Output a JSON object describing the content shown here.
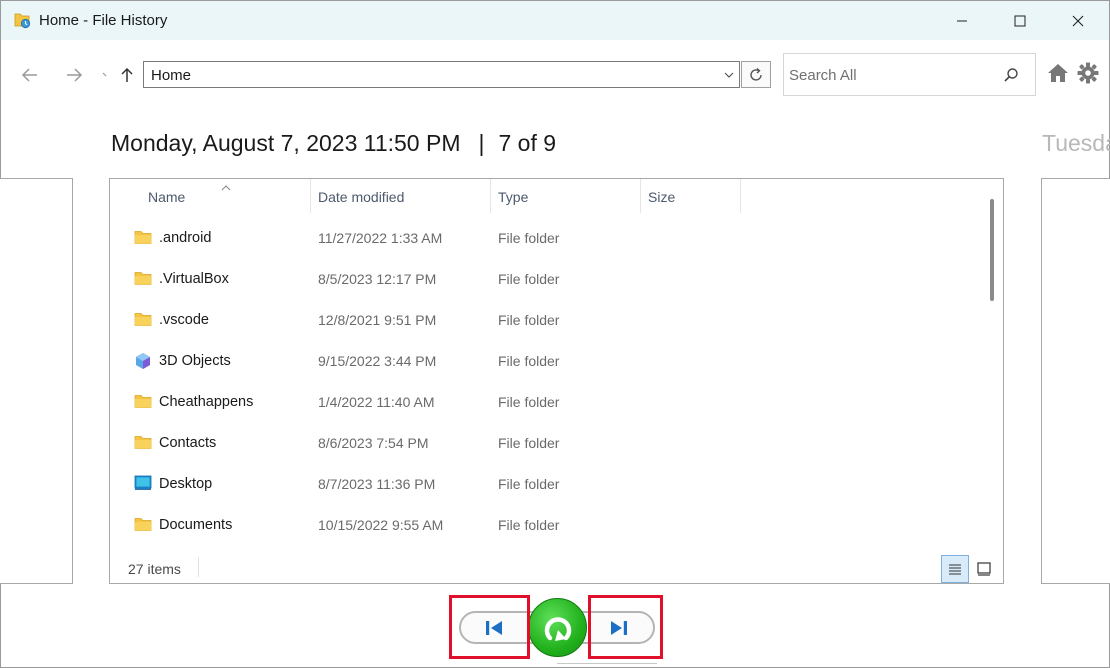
{
  "window": {
    "title": "Home - File History",
    "controls": {
      "minimize": "minimize-icon",
      "maximize": "maximize-icon",
      "close": "close-icon"
    }
  },
  "nav": {
    "address": "Home",
    "search_placeholder": "Search All"
  },
  "header": {
    "date": "Monday, August 7, 2023 11:50 PM",
    "separator": "|",
    "position": "7 of 9",
    "next_date_partial": "Tuesda"
  },
  "columns": [
    "Name",
    "Date modified",
    "Type",
    "Size"
  ],
  "files": [
    {
      "name": ".android",
      "date": "11/27/2022 1:33 AM",
      "type": "File folder",
      "icon": "folder-icon"
    },
    {
      "name": ".VirtualBox",
      "date": "8/5/2023 12:17 PM",
      "type": "File folder",
      "icon": "folder-icon"
    },
    {
      "name": ".vscode",
      "date": "12/8/2021 9:51 PM",
      "type": "File folder",
      "icon": "folder-icon"
    },
    {
      "name": "3D Objects",
      "date": "9/15/2022 3:44 PM",
      "type": "File folder",
      "icon": "3d-objects-icon"
    },
    {
      "name": "Cheathappens",
      "date": "1/4/2022 11:40 AM",
      "type": "File folder",
      "icon": "folder-icon"
    },
    {
      "name": "Contacts",
      "date": "8/6/2023 7:54 PM",
      "type": "File folder",
      "icon": "folder-icon"
    },
    {
      "name": "Desktop",
      "date": "8/7/2023 11:36 PM",
      "type": "File folder",
      "icon": "desktop-icon"
    },
    {
      "name": "Documents",
      "date": "10/15/2022 9:55 AM",
      "type": "File folder",
      "icon": "folder-icon"
    }
  ],
  "status": {
    "item_count": "27 items"
  },
  "colors": {
    "titlebar_bg": "#eaf6f8",
    "restore_green": "#22b11d",
    "highlight_red": "#e0102a",
    "folder_yellow": "#f4c542"
  }
}
